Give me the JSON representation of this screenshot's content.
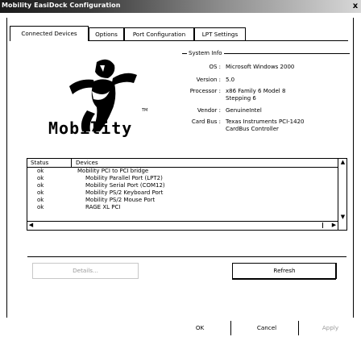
{
  "window": {
    "title": "Mobility EasiDock Configuration",
    "close_glyph": "x"
  },
  "tabs": [
    {
      "label": "Connected Devices",
      "active": true
    },
    {
      "label": "Options",
      "active": false
    },
    {
      "label": "Port Configuration",
      "active": false
    },
    {
      "label": "LPT Settings",
      "active": false
    }
  ],
  "logo": {
    "word": "Mobility",
    "tm": "TM"
  },
  "system_info": {
    "legend": "System Info",
    "rows": [
      {
        "label": "OS :",
        "value": "Microsoft Windows 2000"
      },
      {
        "label": "Version :",
        "value": "5.0"
      },
      {
        "label": "Processor :",
        "value": "x86 Family 6 Model 8"
      },
      {
        "label": "",
        "value": "Stepping 6"
      },
      {
        "label": "Vendor :",
        "value": "GenuineIntel"
      },
      {
        "label": "Card Bus :",
        "value": "Texas Instruments PCI-1420"
      },
      {
        "label": "",
        "value": "CardBus Controller"
      }
    ]
  },
  "devices": {
    "headers": [
      "Status",
      "Devices"
    ],
    "rows": [
      {
        "status": "ok",
        "device": "Mobility PCI to PCI bridge",
        "indent": 0
      },
      {
        "status": "ok",
        "device": "Mobility Parallel Port (LPT2)",
        "indent": 1
      },
      {
        "status": "ok",
        "device": "Mobility Serial Port (COM12)",
        "indent": 1
      },
      {
        "status": "ok",
        "device": "Mobility PS/2 Keyboard Port",
        "indent": 1
      },
      {
        "status": "ok",
        "device": "Mobility PS/2 Mouse Port",
        "indent": 1
      },
      {
        "status": "ok",
        "device": "RAGE XL  PCI",
        "indent": 1
      }
    ]
  },
  "buttons": {
    "details": "Details...",
    "refresh": "Refresh",
    "ok": "OK",
    "cancel": "Cancel",
    "apply": "Apply"
  }
}
